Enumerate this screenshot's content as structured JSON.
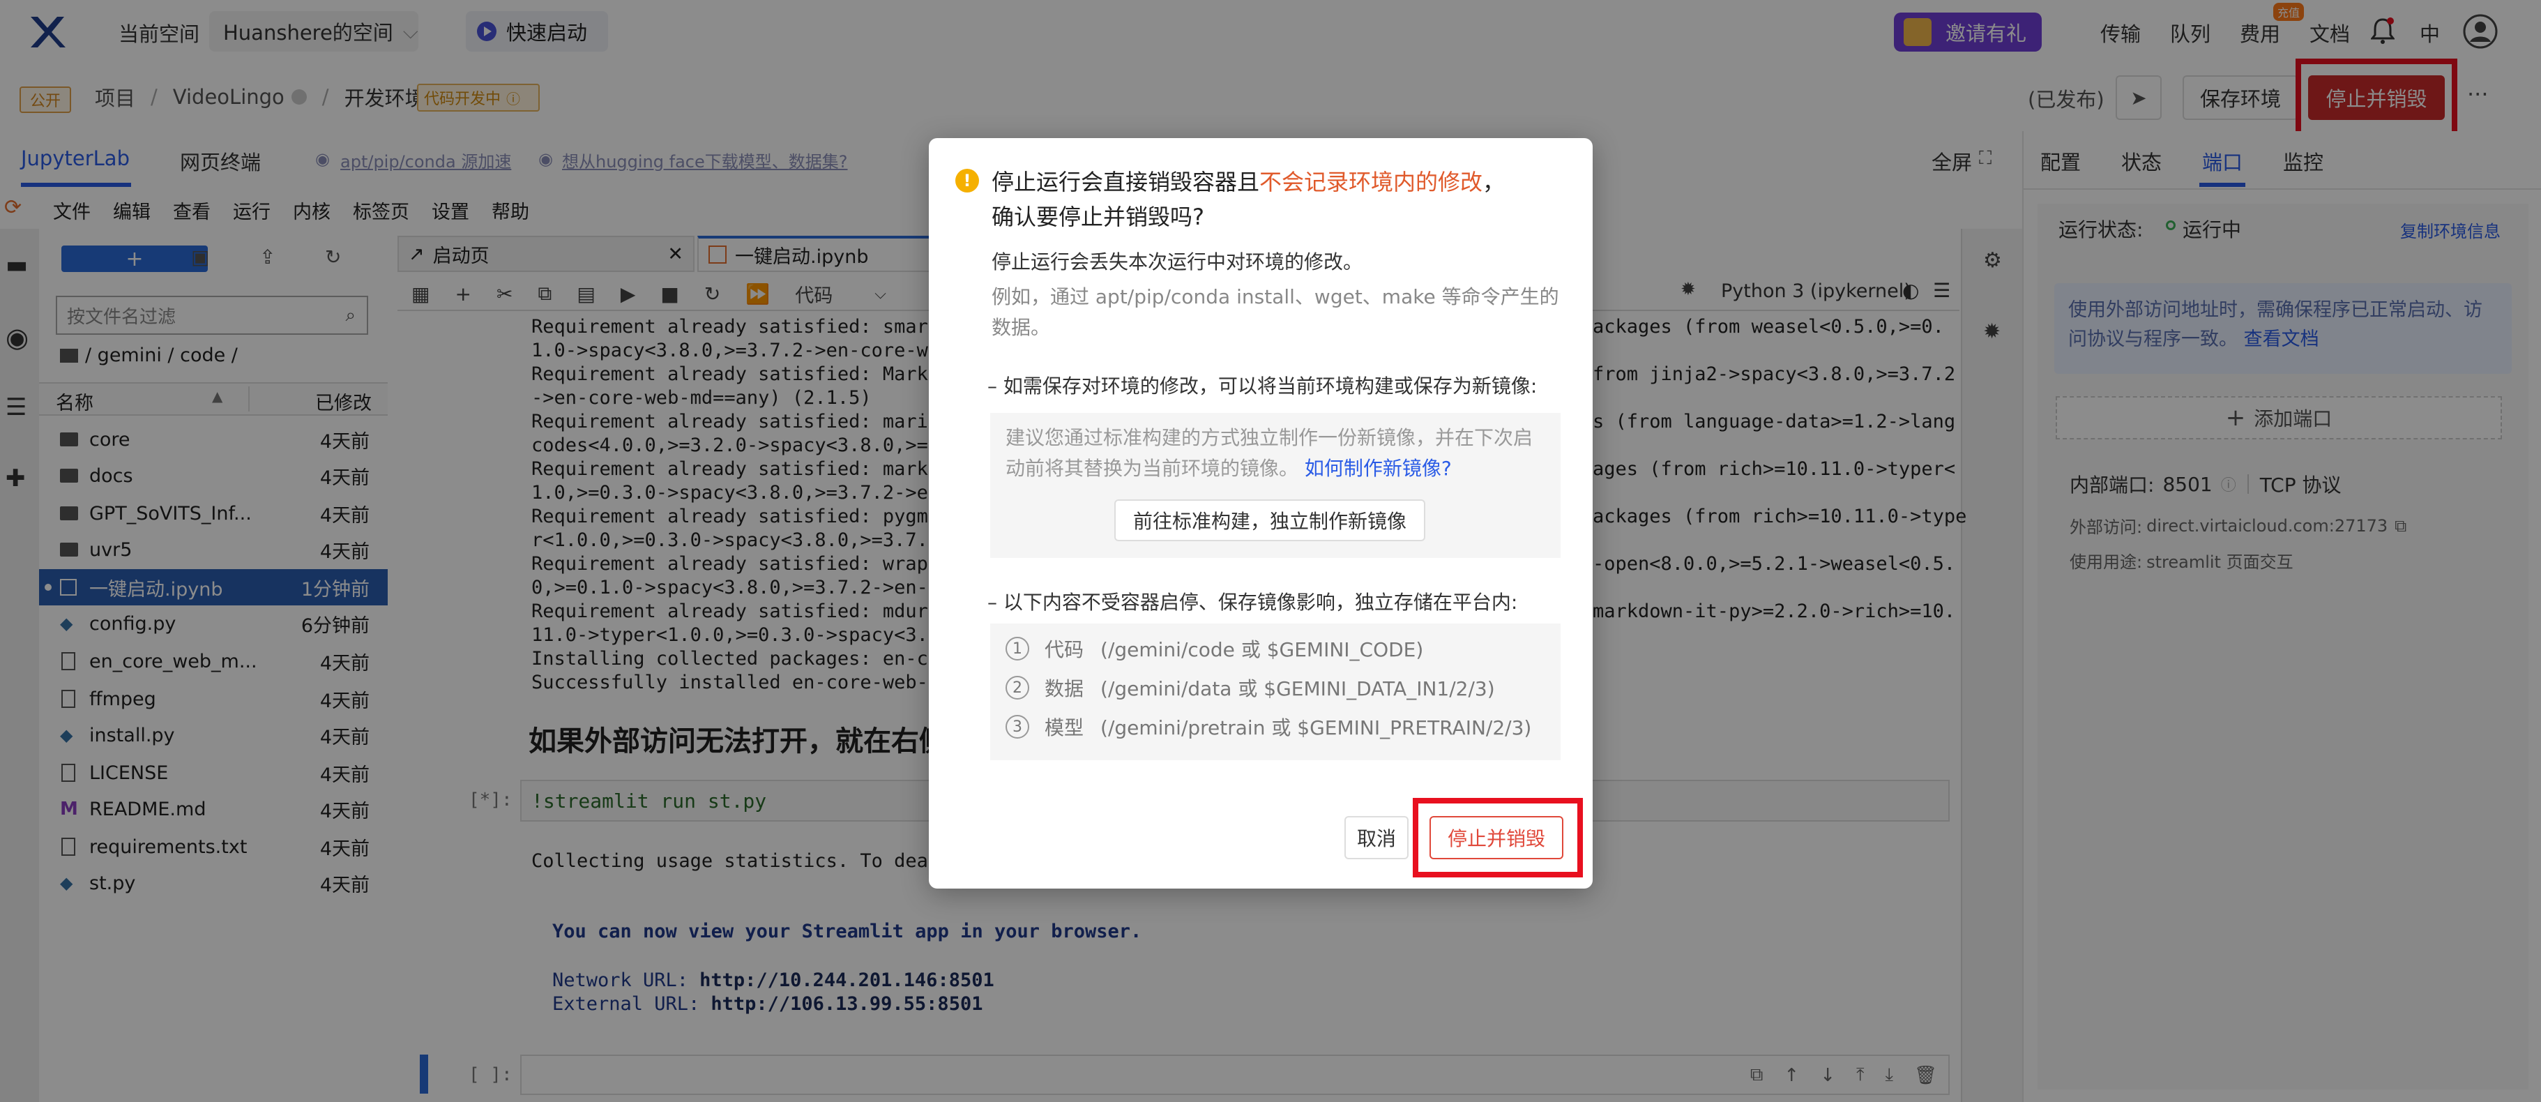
{
  "topbar": {
    "current_space_label": "当前空间",
    "space_name": "Huanshere的空间",
    "quick_start": "快速启动",
    "invite": "邀请有礼",
    "links": [
      "传输",
      "队列",
      "费用",
      "文档"
    ],
    "cost_badge": "充值",
    "language": "中"
  },
  "breadcrumb": {
    "public_tag": "公开",
    "items": [
      "项目",
      "VideoLingo",
      "开发环境"
    ],
    "dev_tag": "代码开发中",
    "published": "(已发布)",
    "save_env": "保存环境",
    "stop_destroy": "停止并销毁",
    "more": "···"
  },
  "tabs_bar": {
    "jupyterlab": "JupyterLab",
    "web_terminal": "网页终端",
    "tip1": "apt/pip/conda 源加速",
    "tip2": "想从hugging face下载模型、数据集?",
    "fullscreen": "全屏"
  },
  "jupyter_menu": [
    "文件",
    "编辑",
    "查看",
    "运行",
    "内核",
    "标签页",
    "设置",
    "帮助"
  ],
  "file_browser": {
    "search_placeholder": "按文件名过滤",
    "path": "/ gemini / code /",
    "col_name": "名称",
    "col_modified": "已修改",
    "files": [
      {
        "name": "core",
        "time": "4天前",
        "type": "folder"
      },
      {
        "name": "docs",
        "time": "4天前",
        "type": "folder"
      },
      {
        "name": "GPT_SoVITS_Inf...",
        "time": "4天前",
        "type": "folder"
      },
      {
        "name": "uvr5",
        "time": "4天前",
        "type": "folder"
      },
      {
        "name": "一键启动.ipynb",
        "time": "1分钟前",
        "type": "notebook"
      },
      {
        "name": "config.py",
        "time": "6分钟前",
        "type": "python"
      },
      {
        "name": "en_core_web_m...",
        "time": "4天前",
        "type": "file"
      },
      {
        "name": "ffmpeg",
        "time": "4天前",
        "type": "file"
      },
      {
        "name": "install.py",
        "time": "4天前",
        "type": "python"
      },
      {
        "name": "LICENSE",
        "time": "4天前",
        "type": "file"
      },
      {
        "name": "README.md",
        "time": "4天前",
        "type": "markdown"
      },
      {
        "name": "requirements.txt",
        "time": "4天前",
        "type": "file"
      },
      {
        "name": "st.py",
        "time": "4天前",
        "type": "python"
      }
    ]
  },
  "notebook": {
    "tab_launcher": "启动页",
    "tab_notebook": "一键启动.ipynb",
    "cell_type": "代码",
    "kernel": "Python 3 (ipykernel)",
    "output_lines": [
      "Requirement already satisfied: smart-",
      "1.0->spacy<3.8.0,>=3.7.2->en-core-web",
      "Requirement already satisfied: Markup",
      "->en-core-web-md==any) (2.1.5)",
      "Requirement already satisfied: marisa",
      "codes<4.0.0,>=3.2.0->spacy<3.8.0,>=3.",
      "Requirement already satisfied: markdo",
      "1.0,>=0.3.0->spacy<3.8.0,>=3.7.2->en-",
      "Requirement already satisfied: pygmen",
      "r<1.0.0,>=0.3.0->spacy<3.8.0,>=3.7.2-",
      "Requirement already satisfied: wrapt",
      "0,>=0.1.0->spacy<3.8.0,>=3.7.2->en-co",
      "Requirement already satisfied: mdurl",
      "11.0->typer<1.0.0,>=0.3.0->spacy<3.8.",
      "Installing collected packages: en-cor",
      "Successfully installed en-core-web-md"
    ],
    "output_right_lines": [
      "ackages (from weasel<0.5.0,>=0.",
      "",
      "from jinja2->spacy<3.8.0,>=3.7.2",
      "",
      "s (from language-data>=1.2->lang",
      "",
      "ages (from rich>=10.11.0->typer<",
      "",
      "ackages (from rich>=10.11.0->type",
      "",
      "-open<8.0.0,>=5.2.1->weasel<0.5.",
      "",
      "markdown-it-py>=2.2.0->rich>=10.",
      "",
      "",
      ""
    ],
    "heading": "如果外部访问无法打开，就在右侧",
    "cell_prompt": "[*]:",
    "cell_code": "!streamlit run st.py",
    "usage_line": "Collecting usage statistics. To deact",
    "view_line": "You can now view your Streamlit app in your browser.",
    "network_label": "Network URL:",
    "network_url": "http://10.244.201.146:8501",
    "external_label": "External URL:",
    "external_url": "http://106.13.99.55:8501",
    "empty_prompt": "[ ]:"
  },
  "right_panel": {
    "tabs": [
      "配置",
      "状态",
      "端口",
      "监控"
    ],
    "active_tab": "端口",
    "run_state_label": "运行状态:",
    "run_state": "运行中",
    "copy_env": "复制环境信息",
    "info": "使用外部访问地址时，需确保程序已正常启动、访问协议与程序一致。",
    "info_link": "查看文档",
    "add_port": "添加端口",
    "internal_port_label": "内部端口:",
    "internal_port": "8501",
    "protocol": "TCP 协议",
    "external_access_label": "外部访问:",
    "external_access": "direct.virtaicloud.com:27173",
    "usage_label": "使用用途:",
    "usage": "streamlit 页面交互"
  },
  "dialog": {
    "title_part1": "停止运行会直接销毁容器且",
    "title_highlight": "不会记录环境内的修改",
    "title_part2": "，",
    "title_line2": "确认要停止并销毁吗?",
    "lose_changes": "停止运行会丢失本次运行中对环境的修改。",
    "example": "例如，通过 apt/pip/conda install、wget、make 等命令产生的数据。",
    "section1": "– 如需保存对环境的修改，可以将当前环境构建或保存为新镜像:",
    "suggest": "建议您通过标准构建的方式独立制作一份新镜像，并在下次启动前将其替换为当前环境的镜像。",
    "suggest_link": "如何制作新镜像?",
    "build_button": "前往标准构建，独立制作新镜像",
    "section2": "– 以下内容不受容器启停、保存镜像影响，独立存储在平台内:",
    "items": [
      {
        "num": "1",
        "label": "代码",
        "path": "(/gemini/code 或 $GEMINI_CODE)"
      },
      {
        "num": "2",
        "label": "数据",
        "path": "(/gemini/data 或 $GEMINI_DATA_IN1/2/3)"
      },
      {
        "num": "3",
        "label": "模型",
        "path": "(/gemini/pretrain 或 $GEMINI_PRETRAIN/2/3)"
      }
    ],
    "cancel": "取消",
    "confirm": "停止并销毁"
  },
  "colors": {
    "accent_blue": "#2b5ce6",
    "danger_red": "#e8101f",
    "warn_orange": "#e05a2b",
    "selected_file_bg": "#2a5db0"
  }
}
